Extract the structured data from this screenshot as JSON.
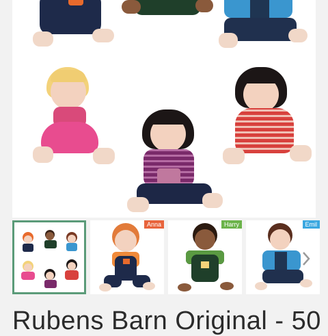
{
  "product": {
    "title": "Rubens Barn Original - 50"
  },
  "gallery": {
    "main_image": "doll-collection-photo",
    "thumbnails": [
      {
        "tag": "",
        "tag_color": "",
        "selected": true
      },
      {
        "tag": "Anna",
        "tag_color": "#e8643c",
        "selected": false
      },
      {
        "tag": "Harry",
        "tag_color": "#6bb34a",
        "selected": false
      },
      {
        "tag": "Emil",
        "tag_color": "#3aa7e0",
        "selected": false
      }
    ],
    "next_icon": "chevron-right-icon"
  }
}
